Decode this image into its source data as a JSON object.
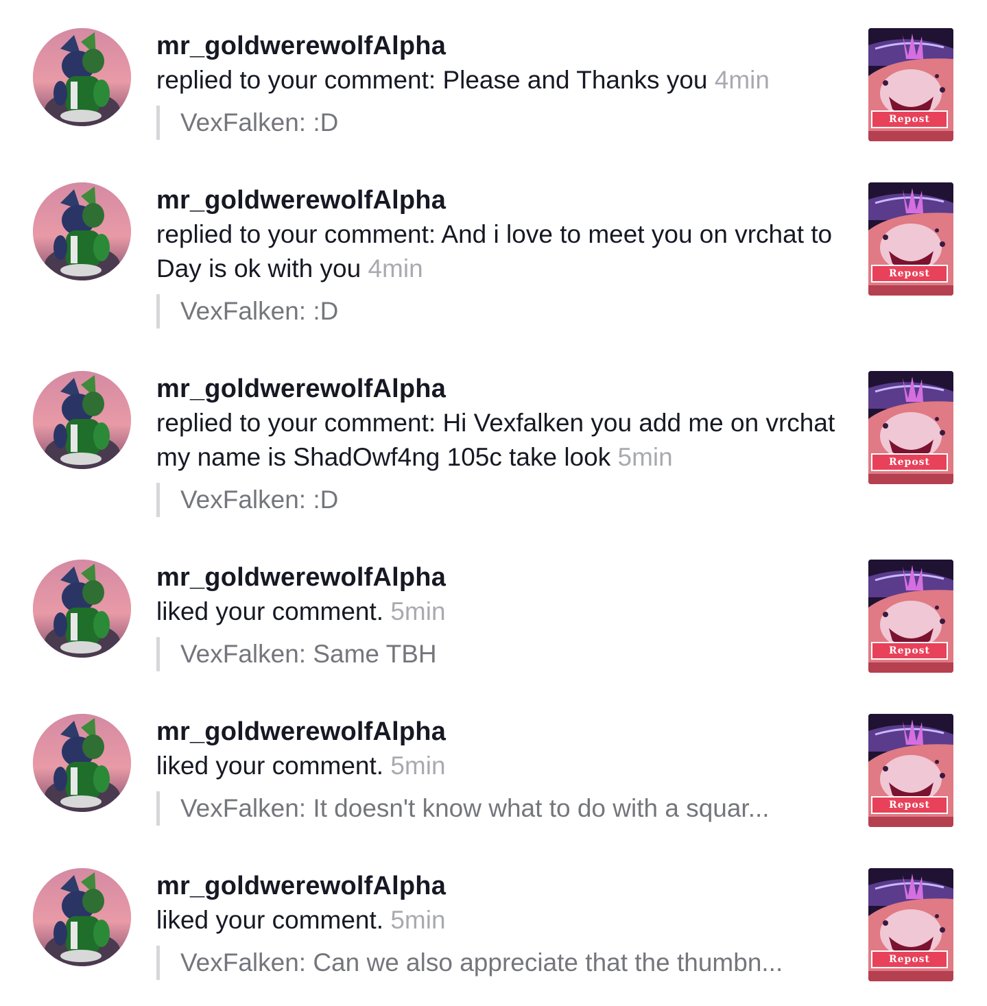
{
  "notifications": [
    {
      "username": "mr_goldwerewolfAlpha",
      "message": "replied to your comment: Please and Thanks you",
      "time": "4min",
      "quote": "VexFalken: :D",
      "thumb_label": "Repost"
    },
    {
      "username": "mr_goldwerewolfAlpha",
      "message": "replied to your comment: And i love to meet you on vrchat to Day is ok with you",
      "time": "4min",
      "quote": "VexFalken: :D",
      "thumb_label": "Repost"
    },
    {
      "username": "mr_goldwerewolfAlpha",
      "message": "replied to your comment: Hi Vexfalken you add me on vrchat my name is ShadOwf4ng 105c take look",
      "time": "5min",
      "quote": "VexFalken: :D",
      "thumb_label": "Repost"
    },
    {
      "username": "mr_goldwerewolfAlpha",
      "message": "liked your comment.",
      "time": "5min",
      "quote": "VexFalken: Same TBH",
      "thumb_label": "Repost"
    },
    {
      "username": "mr_goldwerewolfAlpha",
      "message": "liked your comment.",
      "time": "5min",
      "quote": "VexFalken: It doesn't know what to do with a squar...",
      "thumb_label": "Repost"
    },
    {
      "username": "mr_goldwerewolfAlpha",
      "message": "liked your comment.",
      "time": "5min",
      "quote": "VexFalken: Can we also appreciate that the thumbn...",
      "thumb_label": "Repost"
    }
  ],
  "colors": {
    "text": "#161823",
    "time": "#a9aab0",
    "quote_text": "#75767c",
    "quote_bar": "#d6d7da",
    "repost_tag": "#e8415a"
  },
  "icons": {
    "avatar": "user-avatar-image",
    "thumbnail": "video-thumbnail-image"
  }
}
